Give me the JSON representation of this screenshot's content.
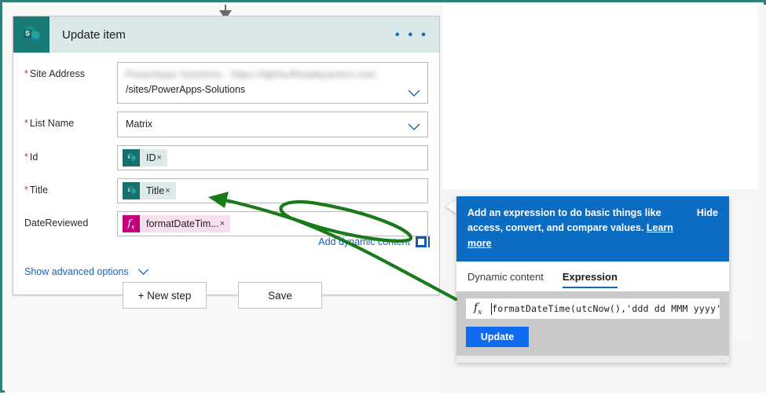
{
  "frame": {
    "border_color": "#2f7f7d"
  },
  "card": {
    "title": "Update item",
    "logo_icon": "sharepoint-icon",
    "ellipsis_label": "• • •",
    "fields": [
      {
        "label": "Site Address",
        "required": true,
        "type": "combo",
        "blurred_prefix": "PowerApps Solutions - https://lightsofheadquarters.com",
        "value": "/sites/PowerApps-Solutions",
        "icon": "chevron-down-icon"
      },
      {
        "label": "List Name",
        "required": true,
        "type": "combo",
        "value": "Matrix",
        "icon": "chevron-down-icon"
      },
      {
        "label": "Id",
        "required": true,
        "type": "token",
        "token": {
          "kind": "sharepoint",
          "text": "ID",
          "remove": "×"
        }
      },
      {
        "label": "Title",
        "required": true,
        "type": "token",
        "token": {
          "kind": "sharepoint",
          "text": "Title",
          "remove": "×"
        }
      },
      {
        "label": "DateReviewed",
        "required": false,
        "type": "token",
        "token": {
          "kind": "expression",
          "text": "formatDateTim...",
          "remove": "×"
        }
      }
    ],
    "dynamic_content_link": "Add dynamic content",
    "advanced_options_link": "Show advanced options"
  },
  "buttons": {
    "new_step": "+ New step",
    "save": "Save"
  },
  "flyout": {
    "banner_text": "Add an expression to do basic things like access, convert, and compare values. ",
    "learn_more": "Learn more",
    "hide": "Hide",
    "tabs": [
      {
        "label": "Dynamic content",
        "active": false
      },
      {
        "label": "Expression",
        "active": true
      }
    ],
    "expression_icon": "fx-icon",
    "expression_value": "formatDateTime(utcNow(),'ddd dd MMM yyyy')",
    "update_button": "Update"
  },
  "annotation": {
    "color": "#1a7a1a",
    "shape": "arrow-with-loop",
    "points_to": "DateReviewed"
  },
  "colors": {
    "sharepoint_teal": "#17706c",
    "expression_magenta": "#c2007b",
    "banner_blue": "#0b6cc4",
    "link_blue": "#1565c0",
    "required_red": "#d13438",
    "header_bg": "#dbe8e8"
  }
}
